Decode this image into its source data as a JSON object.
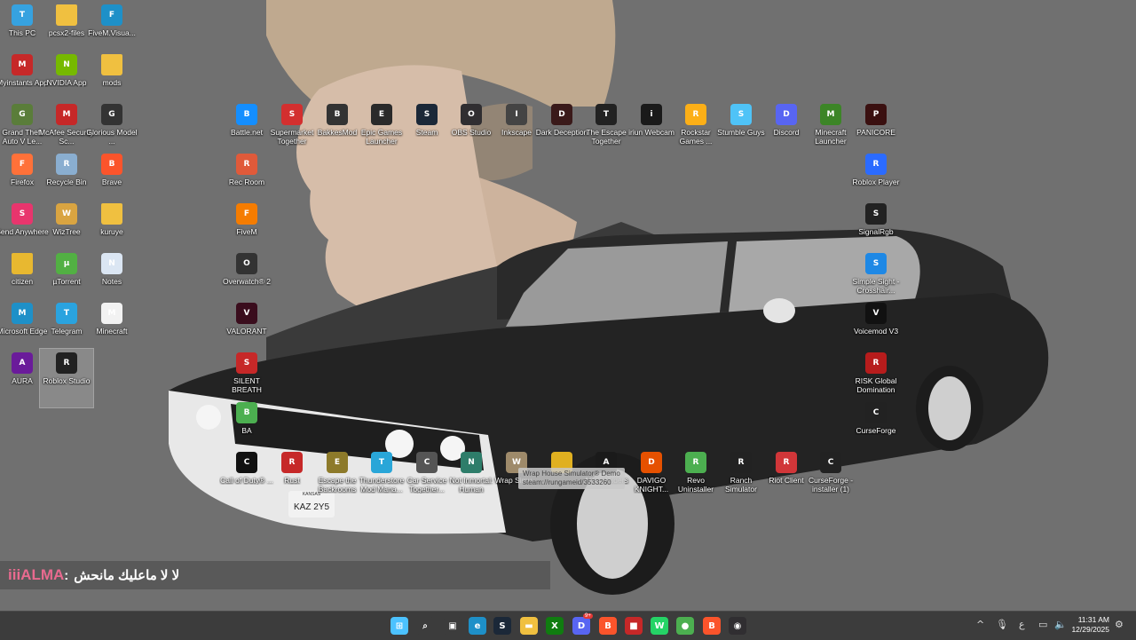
{
  "desktop": {
    "icons": [
      {
        "label": "This PC",
        "icon": "monitor-icon",
        "color": "#36a2e0"
      },
      {
        "label": "pcsx2-files",
        "icon": "folder-icon",
        "color": "#f0c040"
      },
      {
        "label": "FiveM.Visua...",
        "icon": "edge-icon",
        "color": "#1e90c8"
      },
      {
        "label": "Myinstants App",
        "icon": "myinstants-icon",
        "color": "#c62828"
      },
      {
        "label": "NVIDIA App",
        "icon": "nvidia-icon",
        "color": "#76b900"
      },
      {
        "label": "mods",
        "icon": "folder-icon",
        "color": "#f0c040"
      },
      {
        "label": "Grand Theft Auto V Le...",
        "icon": "gta-icon",
        "color": "#5a7d3a"
      },
      {
        "label": "McAfee Security Sc...",
        "icon": "mcafee-icon",
        "color": "#c62828"
      },
      {
        "label": "Glorious Model ...",
        "icon": "glorious-icon",
        "color": "#333333"
      },
      {
        "label": "Firefox",
        "icon": "firefox-icon",
        "color": "#ff7139"
      },
      {
        "label": "Recycle Bin",
        "icon": "recycle-bin-icon",
        "color": "#8aaed0"
      },
      {
        "label": "Brave",
        "icon": "brave-icon",
        "color": "#fb542b"
      },
      {
        "label": "Send Anywhere",
        "icon": "send-anywhere-icon",
        "color": "#e8356d"
      },
      {
        "label": "WizTree",
        "icon": "wiztree-icon",
        "color": "#d9a441"
      },
      {
        "label": "kuruye",
        "icon": "folder-icon",
        "color": "#f0c040"
      },
      {
        "label": "citizen",
        "icon": "folder-icon",
        "color": "#e8b830"
      },
      {
        "label": "µTorrent",
        "icon": "utorrent-icon",
        "color": "#52b043"
      },
      {
        "label": "Notes",
        "icon": "notes-icon",
        "color": "#dbe6f3"
      },
      {
        "label": "Microsoft Edge",
        "icon": "edge-icon",
        "color": "#1e90c8"
      },
      {
        "label": "Telegram",
        "icon": "telegram-icon",
        "color": "#2aa3df"
      },
      {
        "label": "Minecraft",
        "icon": "file-icon",
        "color": "#f2f2f2"
      },
      {
        "label": "AURA",
        "icon": "aura-icon",
        "color": "#6a1b9a"
      },
      {
        "label": "Roblox Studio",
        "icon": "roblox-studio-icon",
        "color": "#222222"
      },
      {
        "label": "Battle.net",
        "icon": "battlenet-icon",
        "color": "#148eff"
      },
      {
        "label": "Supermarket Together",
        "icon": "supermarket-icon",
        "color": "#d32f2f"
      },
      {
        "label": "BakkesMod",
        "icon": "bakkesmod-icon",
        "color": "#333333"
      },
      {
        "label": "Epic Games Launcher",
        "icon": "epic-games-icon",
        "color": "#2a2a2a"
      },
      {
        "label": "Steam",
        "icon": "steam-icon",
        "color": "#1b2838"
      },
      {
        "label": "OBS Studio",
        "icon": "obs-icon",
        "color": "#302e31"
      },
      {
        "label": "Inkscape",
        "icon": "inkscape-icon",
        "color": "#444444"
      },
      {
        "label": "Dark Deception",
        "icon": "dark-deception-icon",
        "color": "#3a1a1a"
      },
      {
        "label": "The Escape Together",
        "icon": "escape-together-icon",
        "color": "#222222"
      },
      {
        "label": "iriun Webcam",
        "icon": "iriun-icon",
        "color": "#1a1a1a"
      },
      {
        "label": "Rockstar Games ...",
        "icon": "rockstar-icon",
        "color": "#fcaf17"
      },
      {
        "label": "Stumble Guys",
        "icon": "stumble-guys-icon",
        "color": "#4fc3f7"
      },
      {
        "label": "Discord",
        "icon": "discord-icon",
        "color": "#5865f2"
      },
      {
        "label": "Minecraft Launcher",
        "icon": "minecraft-icon",
        "color": "#3c8527"
      },
      {
        "label": "PANICORE",
        "icon": "panicore-icon",
        "color": "#3a1010"
      },
      {
        "label": "Rec Room",
        "icon": "rec-room-icon",
        "color": "#e05a3a"
      },
      {
        "label": "Roblox Player",
        "icon": "roblox-icon",
        "color": "#2b6bff"
      },
      {
        "label": "FiveM",
        "icon": "fivem-icon",
        "color": "#f57c00"
      },
      {
        "label": "SignalRgb",
        "icon": "signalrgb-icon",
        "color": "#222222"
      },
      {
        "label": "Overwatch® 2",
        "icon": "overwatch-icon",
        "color": "#333333"
      },
      {
        "label": "Simple Sight - Crosshair...",
        "icon": "crosshair-icon",
        "color": "#1e88e5"
      },
      {
        "label": "VALORANT",
        "icon": "valorant-icon",
        "color": "#3a0d1d"
      },
      {
        "label": "Voicemod V3",
        "icon": "voicemod-icon",
        "color": "#111111"
      },
      {
        "label": "SILENT BREATH",
        "icon": "silent-breath-icon",
        "color": "#c62828"
      },
      {
        "label": "RISK Global Domination",
        "icon": "risk-icon",
        "color": "#b71c1c"
      },
      {
        "label": "BA",
        "icon": "chrome-icon",
        "color": "#4caf50"
      },
      {
        "label": "CurseForge",
        "icon": "curseforge-icon",
        "color": "#222222"
      },
      {
        "label": "Call of Duty® ...",
        "icon": "call-of-duty-icon",
        "color": "#111111"
      },
      {
        "label": "Rust",
        "icon": "rust-icon",
        "color": "#c62828"
      },
      {
        "label": "Escape the Backrooms",
        "icon": "backrooms-icon",
        "color": "#8d7a2a"
      },
      {
        "label": "Thunderstore Mod Mana...",
        "icon": "thunderstore-icon",
        "color": "#29a6d8"
      },
      {
        "label": "Car Service Together...",
        "icon": "car-service-icon",
        "color": "#555555"
      },
      {
        "label": "Not Inmortal: Human",
        "icon": "not-inmortal-icon",
        "color": "#2e7d6a"
      },
      {
        "label": "Wrap Simu...",
        "icon": "wrap-house-icon",
        "color": "#9e8a6a"
      },
      {
        "label": "",
        "icon": "game-icon",
        "color": "#e0b020"
      },
      {
        "label": "ARC Raiders",
        "icon": "arc-raiders-icon",
        "color": "#1a1a1a"
      },
      {
        "label": "DAVIGO KNIGHT...",
        "icon": "davigo-icon",
        "color": "#e65100"
      },
      {
        "label": "Revo Uninstaller",
        "icon": "revo-icon",
        "color": "#4caf50"
      },
      {
        "label": "Ranch Simulator",
        "icon": "ranch-icon",
        "color": "#222222"
      },
      {
        "label": "Riot Client",
        "icon": "riot-icon",
        "color": "#d13639"
      },
      {
        "label": "CurseForge - installer (1)",
        "icon": "curseforge-icon",
        "color": "#222222"
      }
    ],
    "tooltip": {
      "line1": "Wrap House Simulator® Demo",
      "line2": "steam://rungameid/3533260"
    },
    "license_plate": {
      "state": "KANSAS",
      "number": "KAZ 2Y5"
    }
  },
  "chat_overlay": {
    "username": "iiiALMA",
    "separator": " : ",
    "message": "لا لا ماعليك مانحش"
  },
  "taskbar": {
    "apps": [
      {
        "name": "start-button-icon",
        "glyph": "⊞",
        "color": "#4cc2ff"
      },
      {
        "name": "search-icon",
        "glyph": "⌕",
        "color": "#3c3c3c"
      },
      {
        "name": "task-view-icon",
        "glyph": "▣",
        "color": "#3c3c3c"
      },
      {
        "name": "edge-taskbar-icon",
        "glyph": "e",
        "color": "#1e90c8"
      },
      {
        "name": "steam-taskbar-icon",
        "glyph": "S",
        "color": "#1b2838"
      },
      {
        "name": "file-explorer-icon",
        "glyph": "▬",
        "color": "#f0c040"
      },
      {
        "name": "xbox-icon",
        "glyph": "X",
        "color": "#107c10"
      },
      {
        "name": "discord-taskbar-icon",
        "glyph": "D",
        "color": "#5865f2"
      },
      {
        "name": "brave-taskbar-icon",
        "glyph": "B",
        "color": "#fb542b"
      },
      {
        "name": "game-taskbar-icon",
        "glyph": "■",
        "color": "#c62828"
      },
      {
        "name": "whatsapp-icon",
        "glyph": "W",
        "color": "#25d366"
      },
      {
        "name": "chrome-taskbar-icon",
        "glyph": "●",
        "color": "#4caf50"
      },
      {
        "name": "brave-taskbar-icon-2",
        "glyph": "B",
        "color": "#fb542b"
      },
      {
        "name": "obs-taskbar-icon",
        "glyph": "◉",
        "color": "#302e31"
      }
    ],
    "discord_badge": "9+",
    "tray": {
      "chevron": "^",
      "language": "ع",
      "time": "11:31 AM",
      "date": "12/29/2025"
    }
  }
}
